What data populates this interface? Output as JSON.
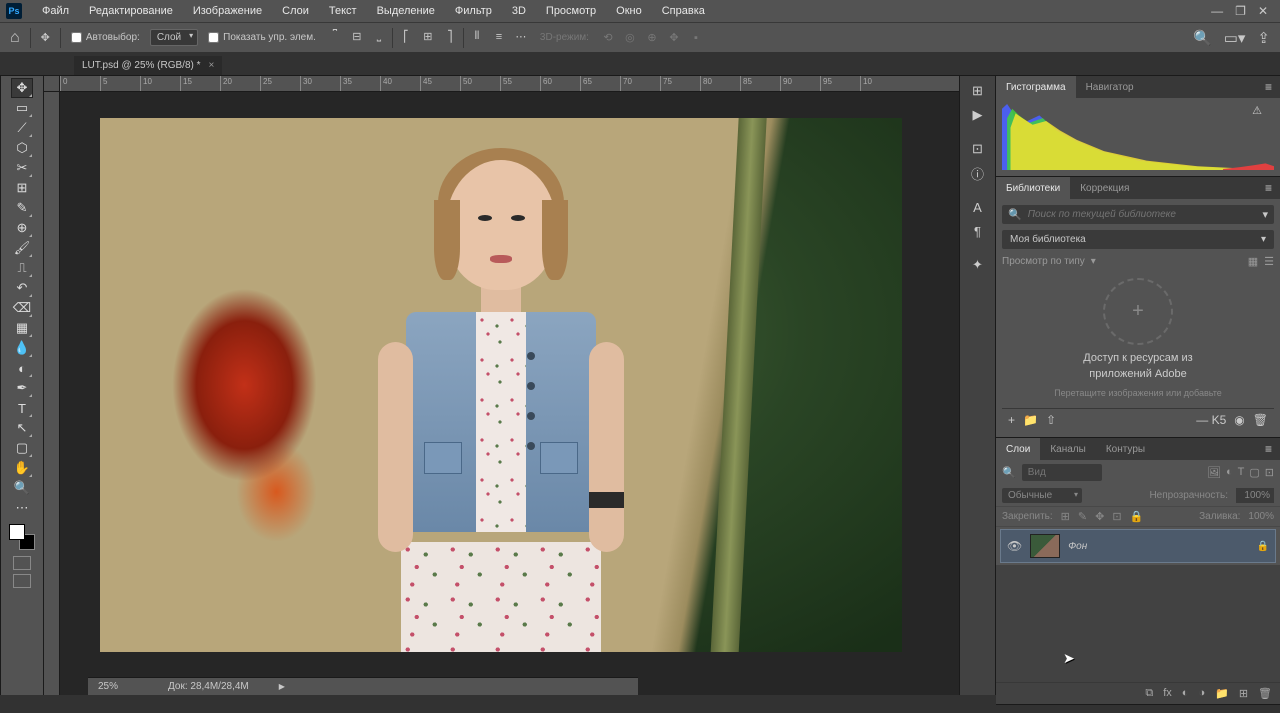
{
  "menubar": [
    "Файл",
    "Редактирование",
    "Изображение",
    "Слои",
    "Текст",
    "Выделение",
    "Фильтр",
    "3D",
    "Просмотр",
    "Окно",
    "Справка"
  ],
  "options": {
    "autoselect": "Автовыбор:",
    "autoselect_target": "Слой",
    "show_controls": "Показать упр. элем.",
    "mode_3d": "3D-режим:"
  },
  "document": {
    "tab_title": "LUT.psd @ 25% (RGB/8) *",
    "ruler_ticks": [
      "0",
      "5",
      "10",
      "15",
      "20",
      "25",
      "30",
      "35",
      "40",
      "45",
      "50",
      "55",
      "60",
      "65",
      "70",
      "75",
      "80",
      "85",
      "90",
      "95",
      "10"
    ]
  },
  "status": {
    "zoom": "25%",
    "doc_size": "Док: 28,4M/28,4M"
  },
  "panels": {
    "histogram": {
      "tabs": [
        "Гистограмма",
        "Навигатор"
      ]
    },
    "libraries": {
      "tabs": [
        "Библиотеки",
        "Коррекция"
      ],
      "search_placeholder": "Поиск по текущей библиотеке",
      "library_name": "Моя библиотека",
      "view_label": "Просмотр по типу",
      "access_title_l1": "Доступ к ресурсам из",
      "access_title_l2": "приложений Adobe",
      "access_sub": "Перетащите изображения или добавьте",
      "k5": "— K5"
    },
    "layers": {
      "tabs": [
        "Слои",
        "Каналы",
        "Контуры"
      ],
      "filter_placeholder": "Вид",
      "blend_mode": "Обычные",
      "opacity_label": "Непрозрачность:",
      "opacity_value": "100%",
      "lock_label": "Закрепить:",
      "fill_label": "Заливка:",
      "fill_value": "100%",
      "layer_name": "Фон"
    }
  }
}
